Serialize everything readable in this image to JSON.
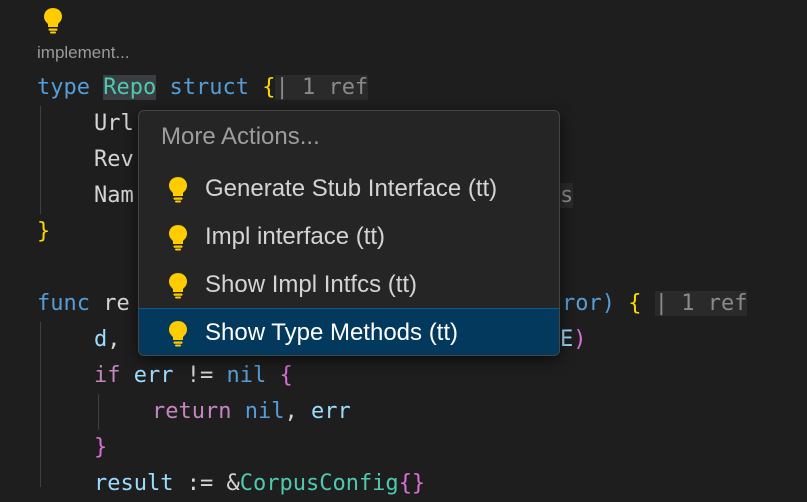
{
  "editor": {
    "codelens_text": "implement...",
    "line1": {
      "kw": "type",
      "name": "Repo",
      "kw2": "struct",
      "brace": "{",
      "sep": "|",
      "refs": "1 ref"
    },
    "line2": {
      "field": "Url"
    },
    "line3": {
      "field": "Rev"
    },
    "line4": {
      "field": "Nam",
      "tail": "s"
    },
    "line5": {
      "brace": "}"
    },
    "line7": {
      "kw": "func",
      "name": "re",
      "after": "ror)",
      "brace": "{",
      "sep": "|",
      "refs": "1 ref"
    },
    "line8": {
      "var": "d",
      "comma": ",",
      "tail_e": "E",
      "paren": ")"
    },
    "line9": {
      "kw": "if",
      "var": "err",
      "op": "!=",
      "nil": "nil",
      "brace": "{"
    },
    "line10": {
      "kw": "return",
      "nil": "nil",
      "comma": ",",
      "err": "err"
    },
    "line11": {
      "brace": "}"
    },
    "line12": {
      "var": "result",
      "op": ":=",
      "amp": "&",
      "type": "CorpusConfig",
      "braces": "{}"
    }
  },
  "context_menu": {
    "header": "More Actions...",
    "items": [
      {
        "label": "Generate Stub Interface (tt)",
        "icon": "lightbulb-icon",
        "selected": false
      },
      {
        "label": "Impl interface (tt)",
        "icon": "lightbulb-icon",
        "selected": false
      },
      {
        "label": "Show Impl Intfcs (tt)",
        "icon": "lightbulb-icon",
        "selected": false
      },
      {
        "label": "Show Type Methods (tt)",
        "icon": "lightbulb-icon",
        "selected": true
      }
    ]
  },
  "colors": {
    "background": "#1e1e1e",
    "lightbulb": "#ffcc00",
    "selection": "#04395e",
    "keyword_blue": "#569cd6",
    "keyword_purple": "#c586c0",
    "type_teal": "#4ec9b0",
    "identifier": "#9cdcfe",
    "brace_yellow": "#ffd700",
    "brace_pink": "#da70d6"
  }
}
